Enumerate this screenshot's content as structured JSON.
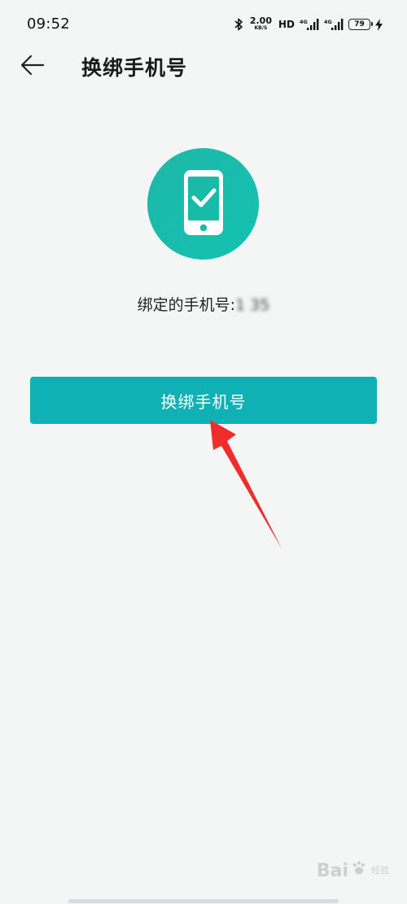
{
  "status_bar": {
    "time": "09:52",
    "net_speed_value": "2.00",
    "net_speed_unit": "KB/S",
    "hd_label": "HD",
    "signal1_label": "4G",
    "signal2_label": "4G",
    "battery_level": "79",
    "icons": [
      "bluetooth-icon",
      "signal-icon",
      "signal-icon",
      "battery-icon",
      "charging-bolt-icon"
    ]
  },
  "app_bar": {
    "back_icon": "arrow-left-icon",
    "title": "换绑手机号"
  },
  "hero": {
    "icon": "phone-check-icon",
    "accent_color": "#16bcaa"
  },
  "bound_phone": {
    "label": "绑定的手机号:",
    "number": "1          35"
  },
  "primary_button": {
    "label": "换绑手机号",
    "color": "#0fb1b5"
  },
  "annotation": {
    "arrow_color": "#f02d2d"
  },
  "watermark": {
    "text": "Bai",
    "sub_top": "经验",
    "sub_bottom": ""
  }
}
